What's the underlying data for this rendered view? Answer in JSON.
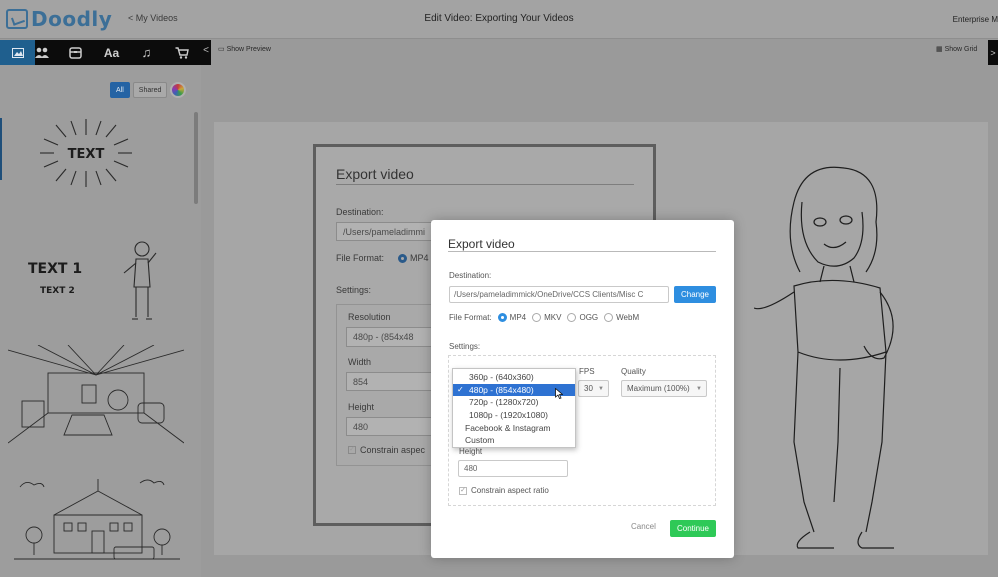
{
  "app": {
    "logo_text": "Doodly",
    "back_link": "< My Videos",
    "page_title": "Edit Video: Exporting Your Videos",
    "account_label": "Enterprise M"
  },
  "toolbar": {
    "tools": [
      {
        "icon": "image-icon",
        "glyph": "▣"
      },
      {
        "icon": "characters-icon",
        "glyph": "👥"
      },
      {
        "icon": "props-icon",
        "glyph": "⊟"
      },
      {
        "icon": "text-icon",
        "glyph": "Aa"
      },
      {
        "icon": "music-icon",
        "glyph": "♫"
      },
      {
        "icon": "cart-icon",
        "glyph": "🛒"
      }
    ],
    "collapse_glyph": "<",
    "show_preview": "Show Preview",
    "show_grid": "Show Grid",
    "expand_glyph": ">"
  },
  "left_panel": {
    "filters": [
      "All",
      "Shared"
    ],
    "assets": [
      {
        "name": "text-burst-asset",
        "text": "TEXT"
      },
      {
        "name": "text-man-asset",
        "text1": "TEXT 1",
        "text2": "TEXT 2"
      },
      {
        "name": "room-asset"
      },
      {
        "name": "school-asset"
      }
    ]
  },
  "background_dialog": {
    "title": "Export video",
    "destination_label": "Destination:",
    "destination_value": "/Users/pameladimmi",
    "file_format_label": "File Format:",
    "file_format_value": "MP4",
    "settings_label": "Settings:",
    "resolution_label": "Resolution",
    "resolution_value": "480p  -  (854x48",
    "width_label": "Width",
    "width_value": "854",
    "height_label": "Height",
    "height_value": "480",
    "constrain_label": "Constrain aspec"
  },
  "export_modal": {
    "title": "Export video",
    "destination_label": "Destination:",
    "destination_value": "/Users/pameladimmick/OneDrive/CCS Clients/Misc C",
    "change_button": "Change",
    "file_format_label": "File Format:",
    "formats": [
      {
        "label": "MP4",
        "selected": true
      },
      {
        "label": "MKV",
        "selected": false
      },
      {
        "label": "OGG",
        "selected": false
      },
      {
        "label": "WebM",
        "selected": false
      }
    ],
    "settings_label": "Settings:",
    "fps_label": "FPS",
    "fps_value": "30",
    "quality_label": "Quality",
    "quality_value": "Maximum (100%)",
    "height_label": "Height",
    "height_value": "480",
    "constrain_label": "Constrain aspect ratio",
    "cancel_button": "Cancel",
    "continue_button": "Continue"
  },
  "resolution_dropdown": {
    "options": [
      {
        "label": "360p  -  (640x360)",
        "selected": false
      },
      {
        "label": "480p  -  (854x480)",
        "selected": true
      },
      {
        "label": "720p  -  (1280x720)",
        "selected": false
      },
      {
        "label": "1080p  -  (1920x1080)",
        "selected": false
      },
      {
        "label": "Facebook & Instagram",
        "selected": false
      },
      {
        "label": "Custom",
        "selected": false
      }
    ]
  },
  "colors": {
    "accent_blue": "#2e8ee0",
    "continue_green": "#2ec957",
    "logo_blue": "#3c6f97",
    "selected_option": "#2e72d2"
  }
}
